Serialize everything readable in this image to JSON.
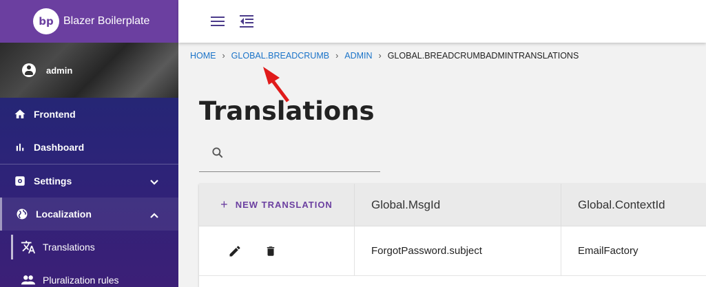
{
  "app": {
    "logo_text": "bp",
    "name": "Blazer Boilerplate"
  },
  "user": {
    "name": "admin"
  },
  "sidebar": {
    "items": [
      {
        "label": "Frontend",
        "icon": "home-icon"
      },
      {
        "label": "Dashboard",
        "icon": "bar-chart-icon"
      },
      {
        "label": "Settings",
        "icon": "gear-icon",
        "expanded": false
      },
      {
        "label": "Localization",
        "icon": "globe-icon",
        "expanded": true
      }
    ],
    "sub_items": [
      {
        "label": "Translations",
        "icon": "translate-icon",
        "selected": true
      },
      {
        "label": "Pluralization rules",
        "icon": "people-icon"
      }
    ]
  },
  "topbar": {
    "menu_icon": "hamburger-menu-icon",
    "collapse_icon": "menu-collapse-icon"
  },
  "breadcrumb": {
    "items": [
      "HOME",
      "GLOBAL.BREADCRUMB",
      "ADMIN"
    ],
    "current": "GLOBAL.BREADCRUMBADMINTRANSLATIONS",
    "separator": "›"
  },
  "page": {
    "title": "Translations"
  },
  "search": {
    "value": "",
    "placeholder": ""
  },
  "table": {
    "new_button": "New Translation",
    "columns": [
      "Global.MsgId",
      "Global.ContextId"
    ],
    "rows": [
      {
        "msg_id": "ForgotPassword.subject",
        "context_id": "EmailFactory"
      }
    ]
  },
  "colors": {
    "accent": "#6b3fa0",
    "link": "#1a73c8",
    "annotation_arrow": "#e01b1b"
  }
}
